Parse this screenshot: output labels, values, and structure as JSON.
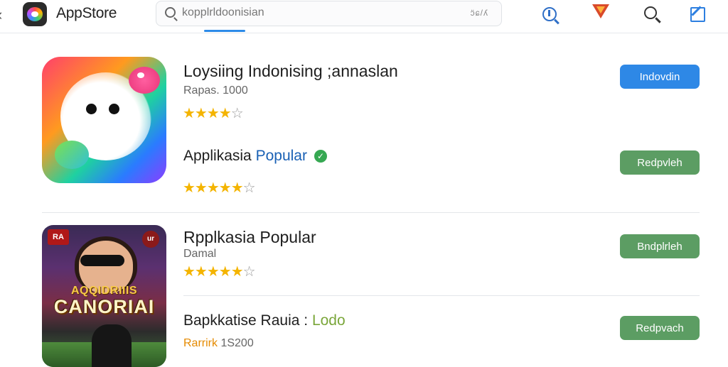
{
  "header": {
    "app_title": "AppStore",
    "search_value": "kopplrldoonisian",
    "search_clear": "ɔ̈ɕ/ʎ"
  },
  "featured": {
    "title": "Loysiing Indonising ;annaslan",
    "meta": "Rapas. 1000",
    "rating": 4,
    "button": "Indovdin",
    "popular_prefix": "Applikasia",
    "popular_word": "Popular",
    "popular_rating": 5,
    "popular_button": "Redpvleh"
  },
  "app_icon_2": {
    "badge_left": "RA",
    "badge_right": "ur",
    "title_small": "AQQIDRIIIS",
    "title_big": "CANORIAI"
  },
  "list": [
    {
      "title": "Rpplkasia Popular",
      "subtitle": "Damal",
      "rating": 5,
      "button": "Bndplrleh"
    },
    {
      "title": "Bapkkatise Rauia :",
      "title_accent": "Lodo",
      "subtitle_accent": "Rarrirk",
      "subtitle": "1S200",
      "button": "Redpvach"
    }
  ],
  "colors": {
    "accent_blue": "#2e88e6",
    "button_green": "#5c9d63",
    "star_gold": "#f4b400",
    "verified_green": "#36a852"
  }
}
